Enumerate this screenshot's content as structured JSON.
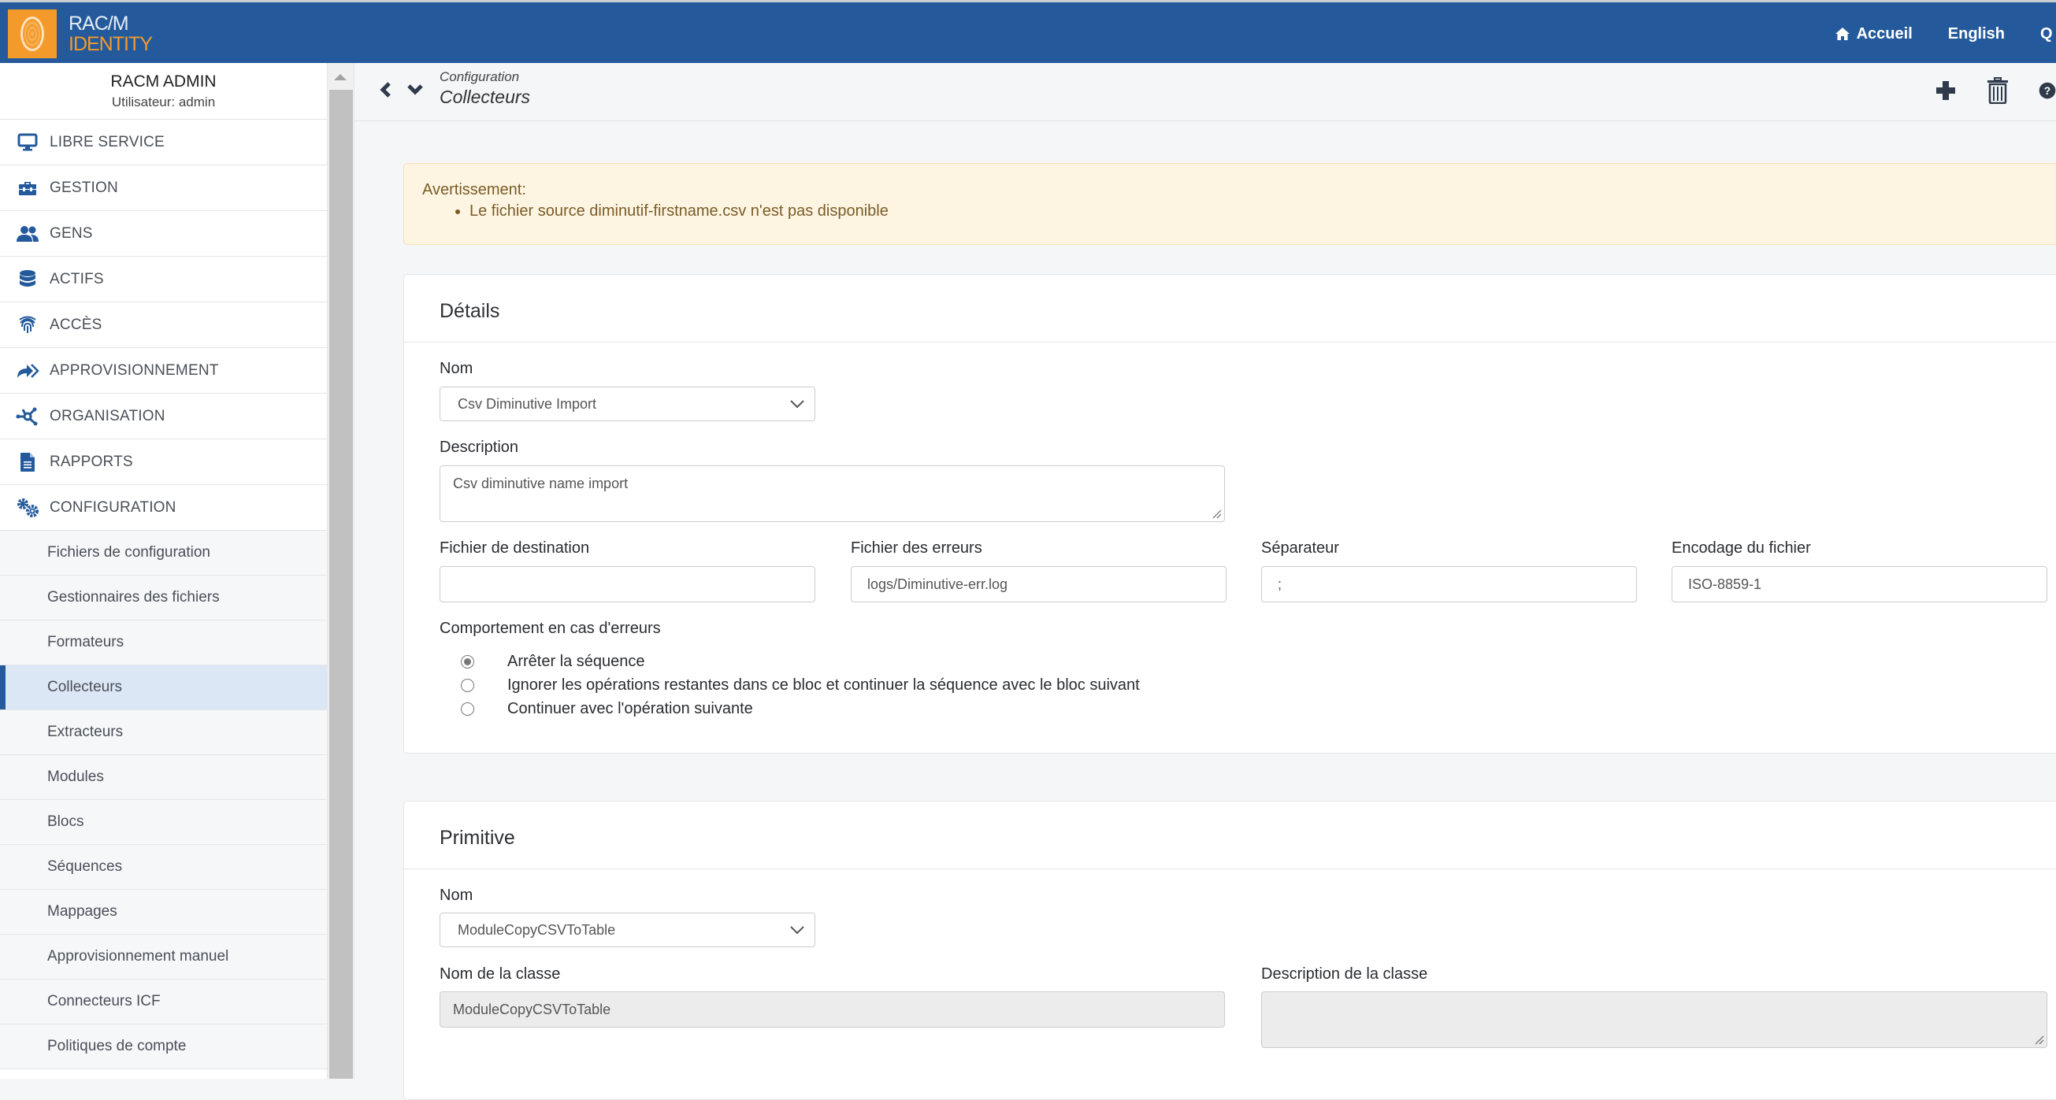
{
  "header": {
    "logo_line1": "RAC/M",
    "logo_line2": "IDENTITY",
    "nav": [
      {
        "label": "Accueil",
        "icon": "home-icon"
      },
      {
        "label": "English"
      },
      {
        "label": "Q"
      }
    ]
  },
  "sidebar": {
    "user_name": "RACM ADMIN",
    "user_role": "Utilisateur: admin",
    "items": [
      {
        "label": "LIBRE SERVICE",
        "icon": "desktop-icon"
      },
      {
        "label": "GESTION",
        "icon": "toolbox-icon"
      },
      {
        "label": "GENS",
        "icon": "users-icon"
      },
      {
        "label": "ACTIFS",
        "icon": "database-icon"
      },
      {
        "label": "ACCÈS",
        "icon": "fingerprint-icon"
      },
      {
        "label": "APPROVISIONNEMENT",
        "icon": "share-forward-icon"
      },
      {
        "label": "ORGANISATION",
        "icon": "network-icon"
      },
      {
        "label": "RAPPORTS",
        "icon": "file-text-icon"
      },
      {
        "label": "CONFIGURATION",
        "icon": "cogs-icon"
      }
    ],
    "sub_items": [
      {
        "label": "Fichiers de configuration"
      },
      {
        "label": "Gestionnaires des fichiers"
      },
      {
        "label": "Formateurs"
      },
      {
        "label": "Collecteurs",
        "active": true
      },
      {
        "label": "Extracteurs"
      },
      {
        "label": "Modules"
      },
      {
        "label": "Blocs"
      },
      {
        "label": "Séquences"
      },
      {
        "label": "Mappages"
      },
      {
        "label": "Approvisionnement manuel"
      },
      {
        "label": "Connecteurs ICF"
      },
      {
        "label": "Politiques de compte"
      }
    ]
  },
  "toolbar": {
    "breadcrumb_parent": "Configuration",
    "breadcrumb_current": "Collecteurs",
    "actions": [
      "add",
      "delete",
      "help"
    ]
  },
  "alert": {
    "title": "Avertissement:",
    "messages": [
      "Le fichier source diminutif-firstname.csv n'est pas disponible"
    ]
  },
  "details": {
    "title": "Détails",
    "nom_label": "Nom",
    "nom_value": "Csv Diminutive Import",
    "description_label": "Description",
    "description_value": "Csv diminutive name import",
    "dest_label": "Fichier de destination",
    "dest_value": "",
    "errors_label": "Fichier des erreurs",
    "errors_value": "logs/Diminutive-err.log",
    "separator_label": "Séparateur",
    "separator_value": ";",
    "encoding_label": "Encodage du fichier",
    "encoding_value": "ISO-8859-1",
    "behavior_label": "Comportement en cas d'erreurs",
    "behavior_options": [
      {
        "label": "Arrêter la séquence",
        "checked": true
      },
      {
        "label": "Ignorer les opérations restantes dans ce bloc et continuer la séquence avec le bloc suivant",
        "checked": false
      },
      {
        "label": "Continuer avec l'opération suivante",
        "checked": false
      }
    ]
  },
  "primitive": {
    "title": "Primitive",
    "nom_label": "Nom",
    "nom_value": "ModuleCopyCSVToTable",
    "class_name_label": "Nom de la classe",
    "class_name_value": "ModuleCopyCSVToTable",
    "class_desc_label": "Description de la classe",
    "class_desc_value": ""
  },
  "colors": {
    "brand_blue": "#245a9c",
    "logo_orange": "#f39a2a",
    "warning_bg": "#fdf5e2",
    "warning_text": "#7a5c28",
    "active_item_bg": "#dce7f6"
  }
}
